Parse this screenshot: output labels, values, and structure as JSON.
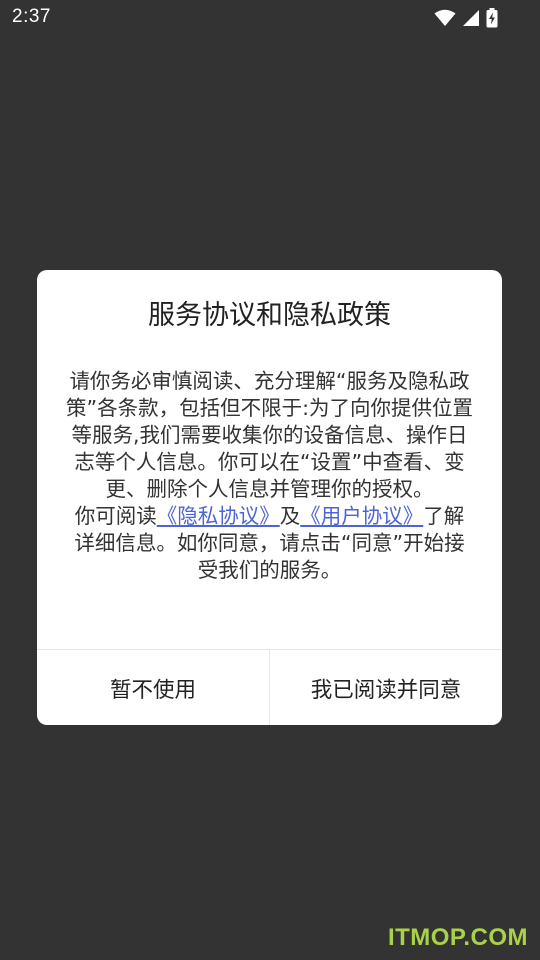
{
  "status_bar": {
    "time": "2:37",
    "icons": [
      "wifi-icon",
      "cell-signal-icon",
      "battery-charging-icon"
    ]
  },
  "dialog": {
    "title": "服务协议和隐私政策",
    "body_paragraph_1": "请你务必审慎阅读、充分理解“服务及隐私政策”各条款，包括但不限于:为了向你提供位置等服务,我们需要收集你的设备信息、操作日志等个人信息。你可以在“设置”中查看、变更、删除个人信息并管理你的授权。",
    "body_paragraph_2_prefix": "你可阅读",
    "privacy_link": "《隐私协议》",
    "body_paragraph_2_middle": "及",
    "user_link": "《用户协议》",
    "body_paragraph_2_suffix": "了解详细信息。如你同意，请点击“同意”开始接受我们的服务。",
    "decline_label": "暂不使用",
    "accept_label": "我已阅读并同意"
  },
  "watermark": "ITMOP.COM",
  "colors": {
    "background": "#333333",
    "link": "#4c64d6",
    "watermark": "#a9d24a"
  }
}
